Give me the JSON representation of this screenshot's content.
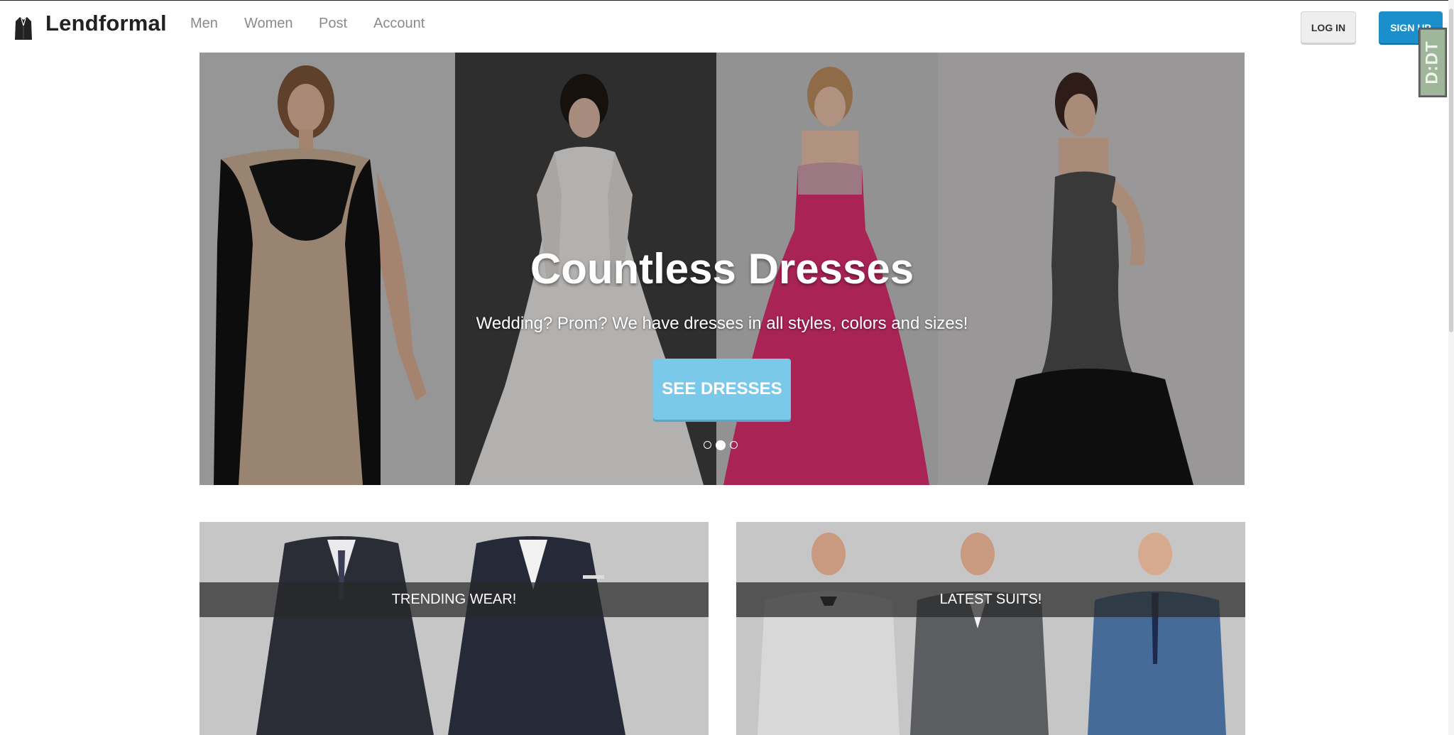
{
  "brand": {
    "name": "Lendformal",
    "icon": "jacket-icon"
  },
  "nav": {
    "items": [
      {
        "label": "Men"
      },
      {
        "label": "Women"
      },
      {
        "label": "Post"
      },
      {
        "label": "Account"
      }
    ],
    "login_label": "LOG IN",
    "signup_label": "SIGN UP"
  },
  "extension_badge": {
    "label": "D:DT"
  },
  "hero": {
    "title": "Countless Dresses",
    "subtitle": "Wedding? Prom? We have dresses in all styles, colors and sizes!",
    "button_label": "SEE DRESSES",
    "slides_total": 3,
    "active_slide": 2
  },
  "cards": [
    {
      "label": "TRENDING WEAR!"
    },
    {
      "label": "LATEST SUITS!"
    }
  ],
  "colors": {
    "signup_bg": "#1b8fcc",
    "hero_button_bg": "#7ac8ea",
    "band_bg": "#282828"
  }
}
